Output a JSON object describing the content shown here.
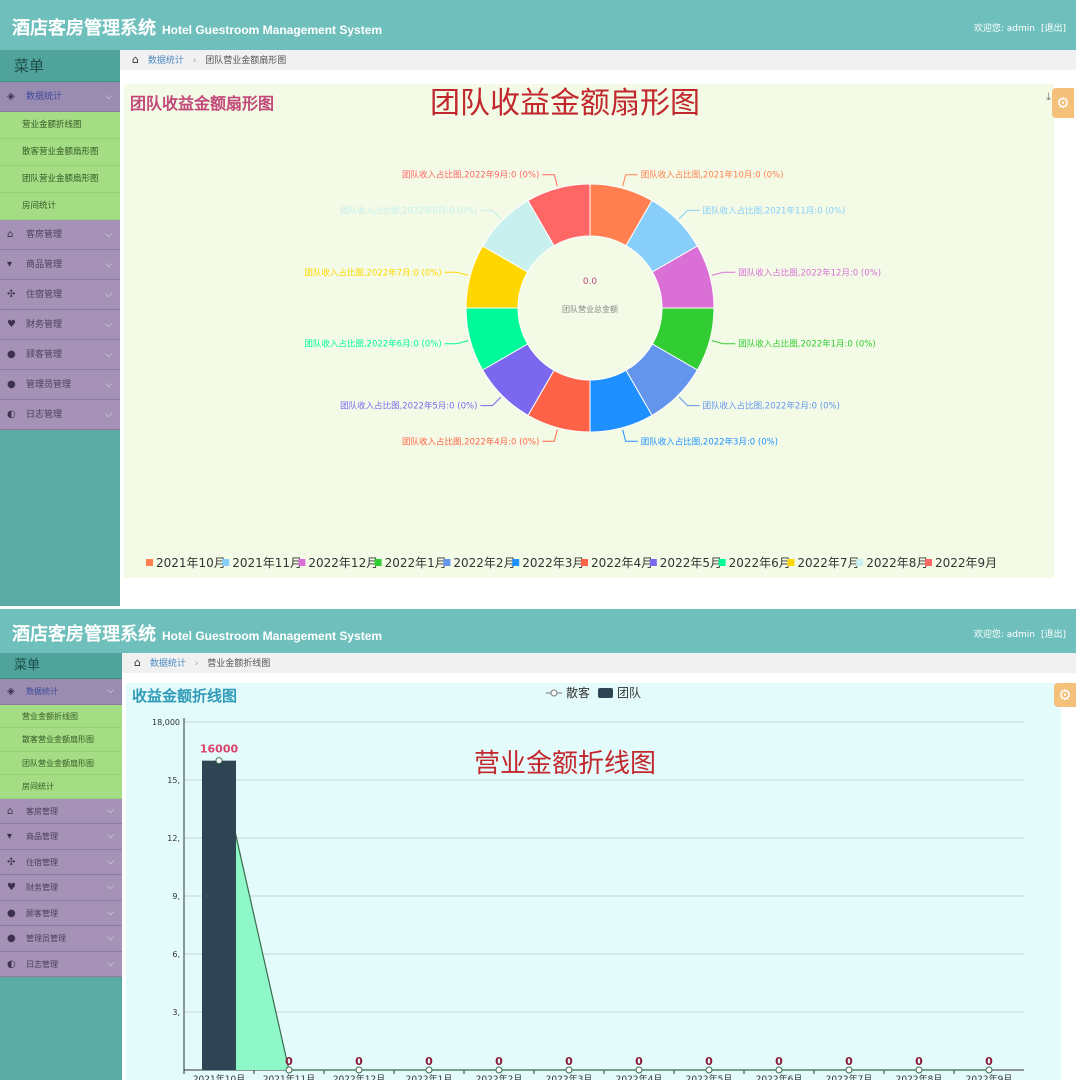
{
  "app": {
    "title_zh": "酒店客房管理系统",
    "title_en": "Hotel Guestroom Management System",
    "welcome": "欢迎您: admin",
    "logout": "[退出]"
  },
  "sidebar": {
    "menu_title": "菜单",
    "items": [
      {
        "label": "数据统计",
        "icon": "dashboard-icon",
        "active": true
      },
      {
        "label": "客房管理",
        "icon": "home-icon"
      },
      {
        "label": "商品管理",
        "icon": "cup-icon"
      },
      {
        "label": "住宿管理",
        "icon": "move-icon"
      },
      {
        "label": "财务管理",
        "icon": "heart-icon"
      },
      {
        "label": "顾客管理",
        "icon": "user-icon"
      },
      {
        "label": "管理员管理",
        "icon": "admin-icon"
      },
      {
        "label": "日志管理",
        "icon": "half-circle-icon"
      }
    ],
    "sub_items": [
      "营业金额折线图",
      "散客营业金额扇形图",
      "团队营业金额扇形图",
      "房间统计"
    ]
  },
  "screen1": {
    "breadcrumb": {
      "root": "数据统计",
      "current": "团队营业金额扇形图"
    },
    "panel_title": "团队收益金额扇形图",
    "big_caption": "团队收益金额扇形图"
  },
  "screen2": {
    "breadcrumb": {
      "root": "数据统计",
      "current": "营业金额折线图"
    },
    "panel_title": "收益金额折线图",
    "big_caption": "营业金额折线图"
  },
  "chart_data": [
    {
      "type": "pie",
      "variant": "donut",
      "center_value": "0.0",
      "center_label": "团队营业总金额",
      "categories": [
        "2021年10月",
        "2021年11月",
        "2022年12月",
        "2022年1月",
        "2022年2月",
        "2022年3月",
        "2022年4月",
        "2022年5月",
        "2022年6月",
        "2022年7月",
        "2022年8月",
        "2022年9月"
      ],
      "values": [
        0,
        0,
        0,
        0,
        0,
        0,
        0,
        0,
        0,
        0,
        0,
        0
      ],
      "slice_labels": [
        "团队收入占比图,2021年10月:0 (0%)",
        "团队收入占比图,2021年11月:0 (0%)",
        "团队收入占比图,2022年12月:0 (0%)",
        "团队收入占比图,2022年1月:0 (0%)",
        "团队收入占比图,2022年2月:0 (0%)",
        "团队收入占比图,2022年3月:0 (0%)",
        "团队收入占比图,2022年4月:0 (0%)",
        "团队收入占比图,2022年5月:0 (0%)",
        "团队收入占比图,2022年6月:0 (0%)",
        "团队收入占比图,2022年7月:0 (0%)",
        "团队收入占比图,2022年8月:0 (0%)",
        "团队收入占比图,2022年9月:0 (0%)"
      ],
      "colors": [
        "#ff7f50",
        "#87cefa",
        "#da70d6",
        "#32cd32",
        "#6495ed",
        "#1e90ff",
        "#ff6347",
        "#7b68ee",
        "#00fa9a",
        "#ffd700",
        "#c7f0ef",
        "#ff6666"
      ],
      "legend": "bottom"
    },
    {
      "type": "bar",
      "categories": [
        "2021年10月",
        "2021年11月",
        "2022年12月",
        "2022年1月",
        "2022年2月",
        "2022年3月",
        "2022年4月",
        "2022年5月",
        "2022年6月",
        "2022年7月",
        "2022年8月",
        "2022年9月"
      ],
      "series": [
        {
          "name": "散客",
          "type": "line",
          "area": true,
          "values": [
            16000,
            0,
            0,
            0,
            0,
            0,
            0,
            0,
            0,
            0,
            0,
            0
          ],
          "color": "#3b6b4e",
          "area_color": "#8ef8c8"
        },
        {
          "name": "团队",
          "type": "bar",
          "values": [
            16000,
            0,
            0,
            0,
            0,
            0,
            0,
            0,
            0,
            0,
            0,
            0
          ],
          "color": "#2f4554"
        }
      ],
      "data_labels": [
        "16000",
        "0",
        "0",
        "0",
        "0",
        "0",
        "0",
        "0",
        "0",
        "0",
        "0",
        "0"
      ],
      "y_ticks": [
        "18,000",
        "15,",
        "12,",
        "9,",
        "6,",
        "3,"
      ],
      "y_tick_values": [
        18000,
        15000,
        12000,
        9000,
        6000,
        3000
      ],
      "ylim": [
        0,
        18000
      ],
      "legend": "top-center",
      "grid": true
    }
  ]
}
